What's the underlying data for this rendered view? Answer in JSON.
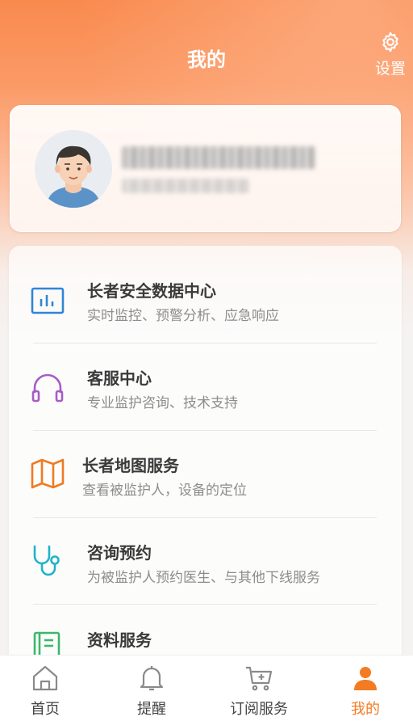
{
  "header": {
    "title": "我的",
    "settings_label": "设置"
  },
  "profile": {
    "username": "user1888123456789",
    "user_id": "ID:1234567890"
  },
  "menu": {
    "items": [
      {
        "title": "长者安全数据中心",
        "subtitle": "实时监控、预警分析、应急响应",
        "icon": "chart-icon"
      },
      {
        "title": "客服中心",
        "subtitle": "专业监护咨询、技术支持",
        "icon": "headset-icon"
      },
      {
        "title": "长者地图服务",
        "subtitle": "查看被监护人，设备的定位",
        "icon": "map-icon"
      },
      {
        "title": "咨询预约",
        "subtitle": "为被监护人预约医生、与其他下线服务",
        "icon": "stethoscope-icon"
      },
      {
        "title": "资料服务",
        "subtitle": "",
        "icon": "document-icon"
      }
    ]
  },
  "tabbar": {
    "tabs": [
      {
        "label": "首页",
        "icon": "home-icon"
      },
      {
        "label": "提醒",
        "icon": "bell-icon"
      },
      {
        "label": "订阅服务",
        "icon": "cart-icon"
      },
      {
        "label": "我的",
        "icon": "user-icon"
      }
    ],
    "active_index": 3,
    "active_color": "#f57b23"
  },
  "colors": {
    "accent": "#f57b23",
    "header_gradient_top": "#f98a4e"
  }
}
